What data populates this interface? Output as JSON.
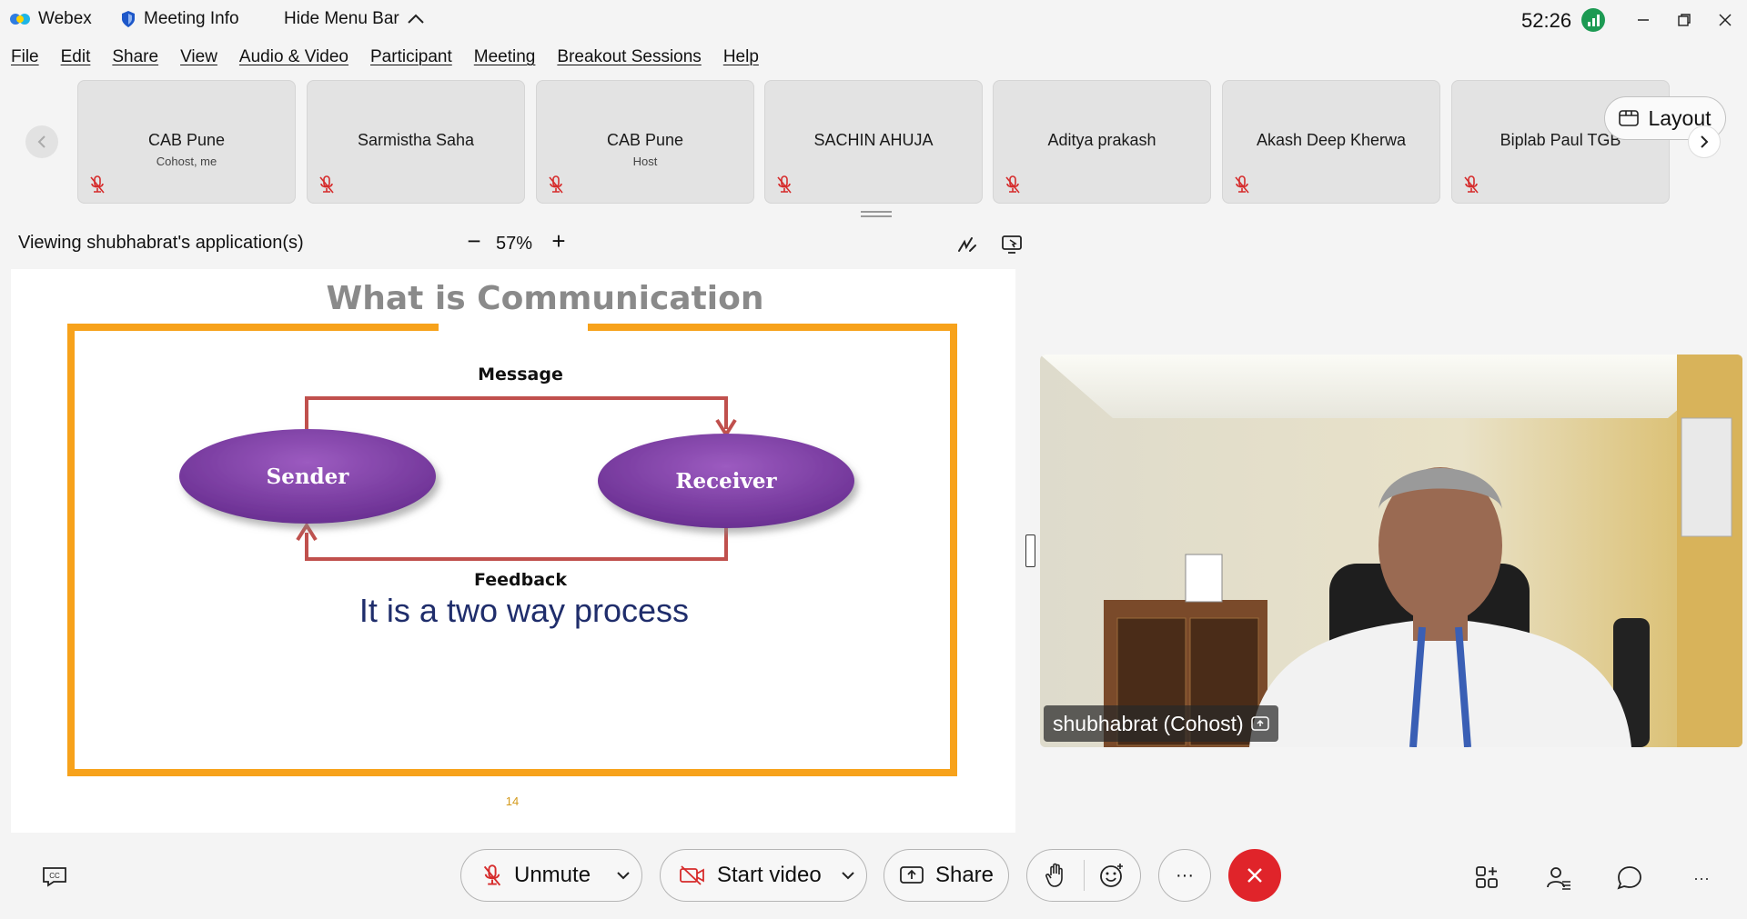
{
  "titlebar": {
    "app_name": "Webex",
    "meeting_info": "Meeting Info",
    "hide_menu": "Hide Menu Bar",
    "timer": "52:26"
  },
  "menu": [
    "File",
    "Edit",
    "Share",
    "View",
    "Audio & Video",
    "Participant",
    "Meeting",
    "Breakout Sessions",
    "Help"
  ],
  "participants": [
    {
      "name": "CAB Pune",
      "role": "Cohost, me"
    },
    {
      "name": "Sarmistha Saha",
      "role": ""
    },
    {
      "name": "CAB Pune",
      "role": "Host"
    },
    {
      "name": "SACHIN AHUJA",
      "role": ""
    },
    {
      "name": "Aditya prakash",
      "role": ""
    },
    {
      "name": "Akash Deep Kherwa",
      "role": ""
    },
    {
      "name": "Biplab Paul TGB",
      "role": ""
    }
  ],
  "layout_button": "Layout",
  "viewing": {
    "label": "Viewing shubhabrat's application(s)",
    "zoom": "57%"
  },
  "slide": {
    "title": "What is Communication",
    "message": "Message",
    "sender": "Sender",
    "receiver": "Receiver",
    "feedback": "Feedback",
    "caption": "It is a two way process",
    "page_number": "14"
  },
  "video": {
    "name_tag": "shubhabrat (Cohost)"
  },
  "toolbar": {
    "unmute": "Unmute",
    "start_video": "Start video",
    "share": "Share",
    "more": "···"
  },
  "colors": {
    "accent_orange": "#f7a21b",
    "ellipse_purple": "#7b3fa0",
    "arrow_red": "#c0504d",
    "end_red": "#e0242a",
    "caption_blue": "#1f2d6b"
  }
}
